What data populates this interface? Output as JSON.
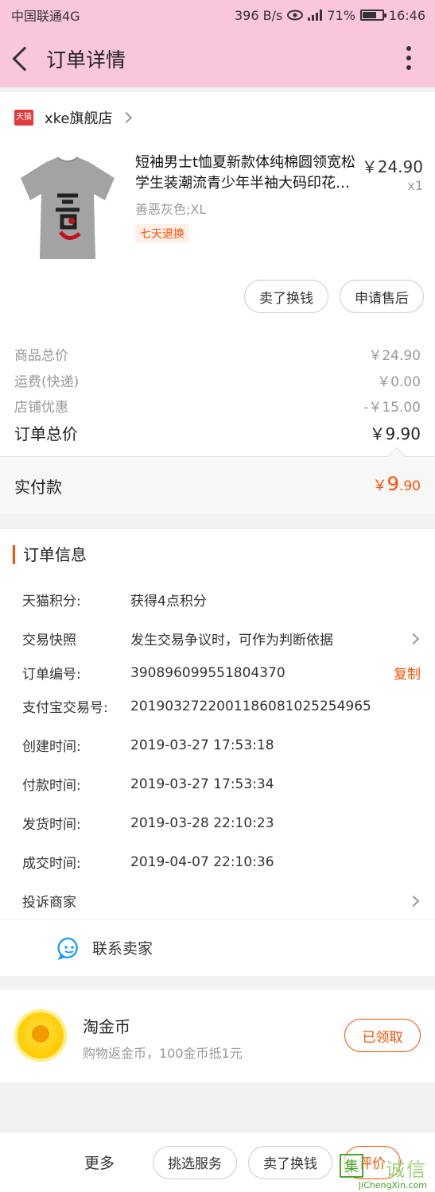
{
  "status_bar": {
    "carrier": "中国联通4G",
    "speed": "396 B/s",
    "battery": "71%",
    "battery_level": 0.71,
    "time": "16:46"
  },
  "header": {
    "title": "订单详情",
    "back_icon": "chevron-left-icon",
    "more_icon": "more-vertical-icon"
  },
  "store": {
    "badge": "天猫",
    "name": "xke旗舰店",
    "product": {
      "title": "短袖男士t恤夏新款体纯棉圆领宽松学生装潮流青少年半袖大码印花男装T恤",
      "price": "￥24.90",
      "qty": "x1",
      "spec": "善恶灰色;XL",
      "tag": "七天退换"
    },
    "buttons": [
      "卖了换钱",
      "申请售后"
    ],
    "fees": [
      {
        "label": "商品总价",
        "value": "￥24.90"
      },
      {
        "label": "运费(快递)",
        "value": "￥0.00"
      },
      {
        "label": "店铺优惠",
        "value": "-￥15.00"
      }
    ],
    "total": {
      "label": "订单总价",
      "value": "￥9.90"
    },
    "paid": {
      "label": "实付款",
      "symbol": "￥",
      "int": "9",
      "dec": ".90"
    }
  },
  "order_info": {
    "title": "订单信息",
    "rows": [
      {
        "label": "天猫积分:",
        "value": "获得4点积分"
      },
      {
        "label": "交易快照",
        "value": "发生交易争议时，可作为判断依据"
      },
      {
        "label": "订单编号:",
        "value": "390896099551804370",
        "action": "复制"
      },
      {
        "label": "支付宝交易号:",
        "value": "2019032722001186081025254965"
      },
      {
        "label": "创建时间:",
        "value": "2019-03-27 17:53:18"
      },
      {
        "label": "付款时间:",
        "value": "2019-03-27 17:53:34"
      },
      {
        "label": "发货时间:",
        "value": "2019-03-28 22:10:23"
      },
      {
        "label": "成交时间:",
        "value": "2019-04-07 22:10:36"
      },
      {
        "label": "投诉商家",
        "value": ""
      }
    ],
    "contact": "联系卖家"
  },
  "coin": {
    "title": "淘金币",
    "subtitle": "购物返金币，100金币抵1元",
    "button": "已领取"
  },
  "bottom_bar": {
    "more": "更多",
    "buttons": [
      "挑选服务",
      "卖了换钱",
      "评价"
    ]
  },
  "watermark": {
    "box": "集",
    "text": "诚信",
    "url": "JiChengXin.com"
  },
  "colors": {
    "header_bg": "#f9c6de",
    "accent": "#ff5000",
    "tmall_red": "#e4393c"
  }
}
